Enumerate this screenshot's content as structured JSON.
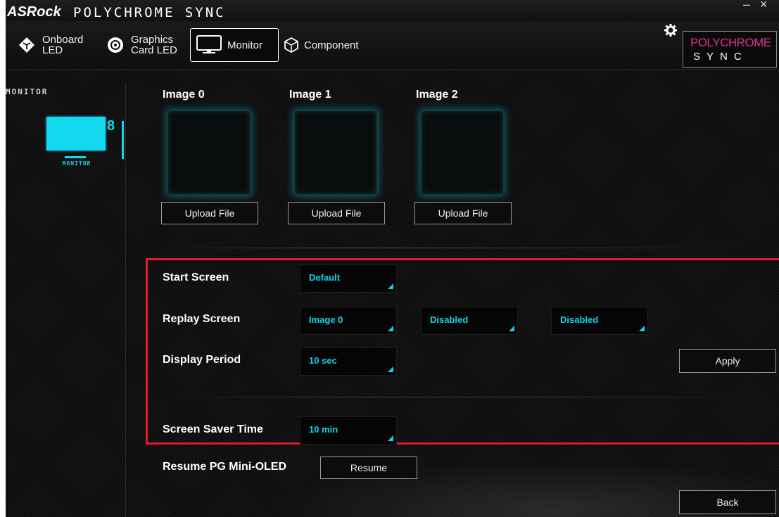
{
  "app": {
    "brand": "ASRock",
    "name": "POLYCHROME SYNC",
    "minimize_glyph": "–",
    "close_glyph": "×"
  },
  "nav": {
    "items": [
      {
        "line1": "Onboard",
        "line2": "LED",
        "icon": "onboard-led-icon"
      },
      {
        "line1": "Graphics",
        "line2": "Card LED",
        "icon": "graphics-card-icon"
      },
      {
        "line1": "Monitor",
        "line2": "",
        "icon": "monitor-icon",
        "active": true
      },
      {
        "line1": "Component",
        "line2": "",
        "icon": "component-cube-icon"
      }
    ],
    "settings_icon": "gear-icon"
  },
  "logo": {
    "top": "POLYCHROME",
    "bottom": "SYNC"
  },
  "sidebar": {
    "title": "MONITOR",
    "device_label": "MONITOR",
    "device_link_glyph": "8"
  },
  "images": [
    {
      "title": "Image 0",
      "button": "Upload File"
    },
    {
      "title": "Image 1",
      "button": "Upload File"
    },
    {
      "title": "Image 2",
      "button": "Upload File"
    }
  ],
  "settings": {
    "start_screen": {
      "label": "Start Screen",
      "value": "Default"
    },
    "replay_screen": {
      "label": "Replay Screen",
      "values": [
        "Image 0",
        "Disabled",
        "Disabled"
      ]
    },
    "display_period": {
      "label": "Display Period",
      "value": "10 sec"
    },
    "apply_label": "Apply",
    "screen_saver": {
      "label": "Screen Saver Time",
      "value": "10 min"
    }
  },
  "resume": {
    "label": "Resume PG Mini-OLED",
    "button": "Resume"
  },
  "back_label": "Back",
  "colors": {
    "accent": "#17d1e6",
    "highlight_border": "#e21a2c",
    "logo_pink": "#d9338f"
  }
}
